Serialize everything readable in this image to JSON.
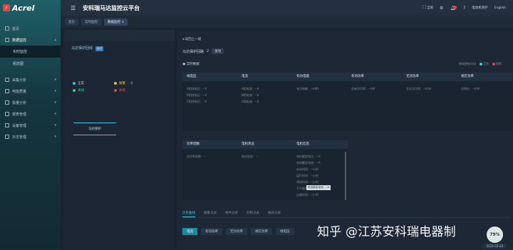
{
  "app": {
    "logo_text": "Acrel",
    "title": "安科瑞马达监控云平台"
  },
  "header": {
    "fullscreen": "全屏",
    "notify_count": "8",
    "user": "电动机保护",
    "language": "English"
  },
  "sidebar": {
    "items": [
      {
        "label": "首页"
      },
      {
        "label": "数据监控"
      },
      {
        "label": "采集分析"
      },
      {
        "label": "电能质量"
      },
      {
        "label": "需量分析"
      },
      {
        "label": "报表管理"
      },
      {
        "label": "设备管理"
      },
      {
        "label": "日志管理"
      }
    ],
    "subitems": [
      {
        "label": "实时监控"
      },
      {
        "label": "组态图"
      }
    ]
  },
  "tabs": [
    {
      "label": "首页"
    },
    {
      "label": "实时监控"
    },
    {
      "label": "数据监控"
    }
  ],
  "left": {
    "motor_title": "马达保护回线",
    "motor_tag": "运行",
    "legend": [
      {
        "label": "正常",
        "value": "",
        "color": "#3fc7dd"
      },
      {
        "label": "报警",
        "value": "0",
        "color": "#e2c341"
      },
      {
        "label": "离线",
        "value": "",
        "color": "#3fc78a"
      },
      {
        "label": "故障",
        "value": "",
        "color": "#e34545"
      }
    ],
    "motor_box": "马达保护"
  },
  "main": {
    "back": "返回上一级",
    "protocol_label": "马达保护回路",
    "protocol_num": "2",
    "protocol_btn": "查询",
    "realtime_title": "实时数据",
    "update_text": "数据更新时间",
    "legend_normal": "正常",
    "legend_alarm": "报警",
    "cards_row1": [
      {
        "title": "线电压",
        "rows": [
          "A相线电压：--V",
          "B相线电压：--V",
          "C相线电压：--V"
        ]
      },
      {
        "title": "电流",
        "rows": [
          "A相电流：--A",
          "B相电流：--A",
          "C相电流：--A"
        ]
      },
      {
        "title": "有功电能",
        "rows": [
          "有功电能：--kWh"
        ]
      },
      {
        "title": "有功功率",
        "rows": [
          "总有功功率：--kW"
        ]
      },
      {
        "title": "无功功率",
        "rows": [
          "总无功功率：--kVar"
        ]
      },
      {
        "title": "视在功率",
        "rows": [
          "总视在：--kVA"
        ]
      }
    ],
    "cards_row2": [
      {
        "title": "功率因数",
        "rows": [
          "总功率因数：--"
        ]
      },
      {
        "title": "电机状态",
        "rows": [
          "电机状态：--"
        ]
      },
      {
        "title": "电机信息",
        "rows": [
          "电机额定电压：--V",
          "电机额定电流：--A",
          "启动时间：--小时",
          "运行时间：--小时",
          "停机时间：--小时",
          "不平衡时间：--小时",
          "过载时间：--小时"
        ]
      }
    ],
    "tooltip": "电机额定电流：--A",
    "subtabs": [
      {
        "label": "历史曲线"
      },
      {
        "label": "报警记录"
      },
      {
        "label": "事件记录"
      },
      {
        "label": "控制记录"
      },
      {
        "label": "报表记录"
      }
    ],
    "btns": [
      {
        "label": "电流"
      },
      {
        "label": "有功功率"
      },
      {
        "label": "无功功率"
      },
      {
        "label": "视在功率"
      },
      {
        "label": "线电压"
      }
    ],
    "date": "2021-03-29"
  },
  "watermark": "知乎 @江苏安科瑞电器制",
  "corner_badge": "79%"
}
